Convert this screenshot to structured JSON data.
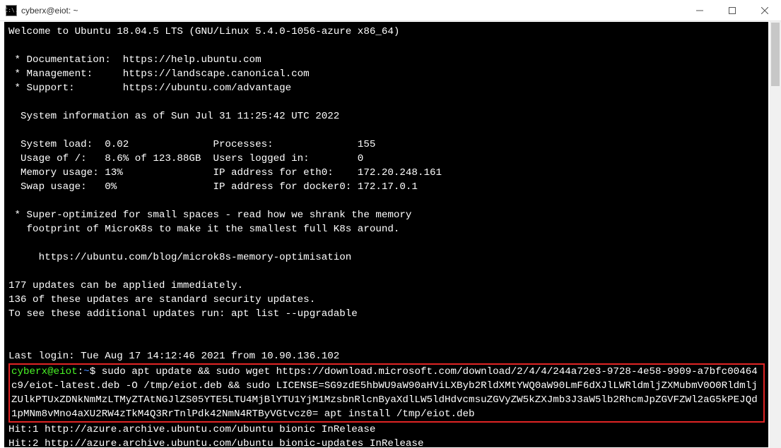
{
  "window": {
    "title": "cyberx@eiot: ~",
    "icon_label": "C:\\."
  },
  "terminal": {
    "welcome": "Welcome to Ubuntu 18.04.5 LTS (GNU/Linux 5.4.0-1056-azure x86_64)",
    "links": [
      " * Documentation:  https://help.ubuntu.com",
      " * Management:     https://landscape.canonical.com",
      " * Support:        https://ubuntu.com/advantage"
    ],
    "sysinfo_header": "  System information as of Sun Jul 31 11:25:42 UTC 2022",
    "sysinfo_rows": [
      "  System load:  0.02              Processes:              155",
      "  Usage of /:   8.6% of 123.88GB  Users logged in:        0",
      "  Memory usage: 13%               IP address for eth0:    172.20.248.161",
      "  Swap usage:   0%                IP address for docker0: 172.17.0.1"
    ],
    "microk8s": [
      " * Super-optimized for small spaces - read how we shrank the memory",
      "   footprint of MicroK8s to make it the smallest full K8s around."
    ],
    "microk8s_url": "     https://ubuntu.com/blog/microk8s-memory-optimisation",
    "updates": [
      "177 updates can be applied immediately.",
      "136 of these updates are standard security updates.",
      "To see these additional updates run: apt list --upgradable"
    ],
    "last_login": "Last login: Tue Aug 17 14:12:46 2021 from 10.90.136.102",
    "prompt_user": "cyberx@eiot",
    "prompt_sep": ":",
    "prompt_path": "~",
    "prompt_sigil": "$",
    "command": "sudo apt update && sudo wget https://download.microsoft.com/download/2/4/4/244a72e3-9728-4e58-9909-a7bfc00464c9/eiot-latest.deb -O /tmp/eiot.deb && sudo LICENSE=SG9zdE5hbWU9aW90aHViLXByb2RldXMtYWQ0aW90LmF6dXJlLWRldmljZXMubmV0O0RldmljZUlkPTUxZDNkNmMzLTMyZTAtNGJlZS05YTE5LTU4MjBlYTU1YjM1MzsbnRlcnByaXdlLW5ldHdvcmsuZGVyZW5kZXJmb3J3aW5lb2RhcmJpZGVFZWl2aG5kPEJQd1pMNm8vMno4aXU2RW4zTkM4Q3RrTnlPdk42NmN4RTByVGtvcz0= apt install /tmp/eiot.deb",
    "hits": [
      "Hit:1 http://azure.archive.ubuntu.com/ubuntu bionic InRelease",
      "Hit:2 http://azure.archive.ubuntu.com/ubuntu bionic-updates InRelease"
    ]
  }
}
